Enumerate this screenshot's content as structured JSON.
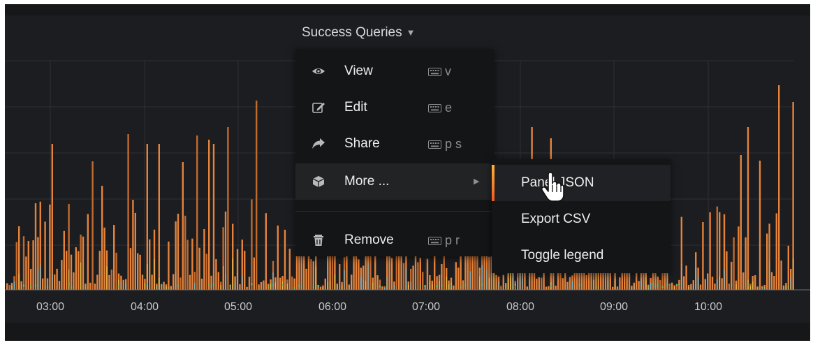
{
  "panel": {
    "title": "Success Queries",
    "x_ticks": [
      "03:00",
      "04:00",
      "05:00",
      "06:00",
      "07:00",
      "08:00",
      "09:00",
      "10:00"
    ]
  },
  "menu": {
    "items": [
      {
        "label": "View",
        "icon": "eye-icon",
        "shortcut": "v"
      },
      {
        "label": "Edit",
        "icon": "edit-icon",
        "shortcut": "e"
      },
      {
        "label": "Share",
        "icon": "share-icon",
        "shortcut": "p s"
      },
      {
        "label": "More ...",
        "icon": "cube-icon",
        "shortcut": ""
      },
      {
        "label": "Remove",
        "icon": "trash-icon",
        "shortcut": "p r"
      }
    ]
  },
  "submenu": {
    "items": [
      {
        "label": "Panel JSON"
      },
      {
        "label": "Export CSV"
      },
      {
        "label": "Toggle legend"
      }
    ]
  },
  "colors": {
    "panel_bg": "#161719",
    "series_orange": "#e5833b",
    "series_yellow": "#e0c14a",
    "series_blue": "#6fb8d6",
    "series_green": "#7eb26d",
    "menu_accent": "#f27a2f"
  }
}
